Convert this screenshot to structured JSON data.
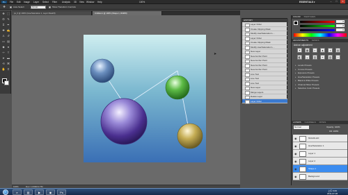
{
  "menubar": {
    "logo": "Ps",
    "items": [
      "File",
      "Edit",
      "Image",
      "Layer",
      "Select",
      "Filter",
      "Analysis",
      "3D",
      "View",
      "Window",
      "Help"
    ],
    "zoom": "100%",
    "workspace": "ESSENTIALS ▾"
  },
  "options": {
    "auto_select": "Auto-Select:",
    "group": "Group",
    "show_transform": "Show Transform Controls"
  },
  "tabs": [
    "ps_0 @ 100% (Hue/Saturation 1, Layer Mask/8)",
    "Untitled-1 @ 100% (Shape 1, RGB/8)"
  ],
  "status": {
    "zoom": "100%",
    "doc": "Doc: 1.03M/14.7M"
  },
  "history": {
    "tabs": [
      "HISTORY"
    ],
    "rows": [
      "Layer Order",
      "Create Clipping Mask",
      "Modify Hue/Saturation L...",
      "Layer Order",
      "Create Clipping Mask",
      "Modify Hue/Saturation L...",
      "New Layer",
      "New Anchor Point",
      "New Anchor Point",
      "New Anchor Point",
      "New Anchor Point",
      "Line Tool",
      "Line Tool",
      "Line Tool",
      "New Layer",
      "Merge Layers",
      "Delete Layer",
      "Layer Order"
    ],
    "selected_index": 17
  },
  "dock": {
    "color_tab": "COLOR",
    "swatches_tab": "SWATCHES",
    "color_values": [
      "0",
      "0",
      "0"
    ],
    "adjustments_tab": "ADJUSTMENTS",
    "masks_tab": "MASKS",
    "add_adjustment": "Add an adjustment",
    "adj_icons": [
      "☀",
      "▦",
      "◐",
      "▲",
      "◑",
      "▤",
      "◧",
      "◒",
      "▥",
      "◓",
      "▨",
      "◔"
    ],
    "presets": [
      "Levels Presets",
      "Curves Presets",
      "Exposure Presets",
      "Hue/Saturation Presets",
      "Black & White Presets",
      "Channel Mixer Presets",
      "Selective Color Presets"
    ],
    "layers_tab": "LAYERS",
    "channels_tab": "CHANNELS",
    "paths_tab": "PATHS",
    "blend_mode": "Normal",
    "opacity": "Opacity: 100%",
    "fill": "Fill: 100%",
    "layers": [
      {
        "name": "MUHOLHO",
        "selected": false
      },
      {
        "name": "Hue/Saturation 1",
        "selected": false
      },
      {
        "name": "Layer 1",
        "selected": false
      },
      {
        "name": "Layer 2",
        "selected": false
      },
      {
        "name": "Shape 1",
        "selected": true
      },
      {
        "name": "Background",
        "selected": false
      }
    ]
  },
  "taskbar": {
    "apps": [
      "e",
      "▤",
      "▶",
      "◉",
      "Ps"
    ],
    "time": "上午 6:29",
    "date": "2011-07-06"
  }
}
